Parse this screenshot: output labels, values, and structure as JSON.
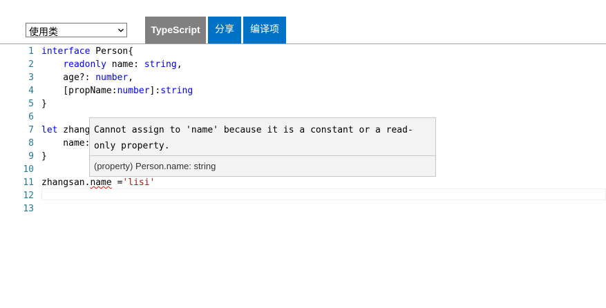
{
  "toolbar": {
    "select_value": "使用类",
    "typescript_label": "TypeScript",
    "share_label": "分享",
    "options_label": "编译项"
  },
  "editor": {
    "line_numbers": [
      "1",
      "2",
      "3",
      "4",
      "5",
      "6",
      "7",
      "8",
      "9",
      "10",
      "11",
      "12",
      "13"
    ],
    "lines": {
      "l1_kw": "interface",
      "l1_rest": " Person{",
      "l2_indent": "    ",
      "l2_kw": "readonly",
      "l2_mid": " name: ",
      "l2_type": "string",
      "l2_end": ",",
      "l3_a": "    age?: ",
      "l3_type": "number",
      "l3_end": ",",
      "l4_a": "    [propName:",
      "l4_type1": "number",
      "l4_b": "]:",
      "l4_type2": "string",
      "l5": "}",
      "l7_kw": "let",
      "l7_rest": " zhang",
      "l8": "    name:",
      "l9": "}",
      "l11_a": "zhangsan.",
      "l11_err": "name",
      "l11_b": " =",
      "l11_str": "'lisi'"
    }
  },
  "hover": {
    "message": "Cannot assign to 'name' because it is a constant or a read-only property.",
    "signature": "(property) Person.name: string"
  },
  "colors": {
    "keyword": "#0000ff",
    "string": "#a31515",
    "line_number": "#237893",
    "button_blue": "#0072c6",
    "button_gray": "#808080",
    "error": "#e51400"
  }
}
